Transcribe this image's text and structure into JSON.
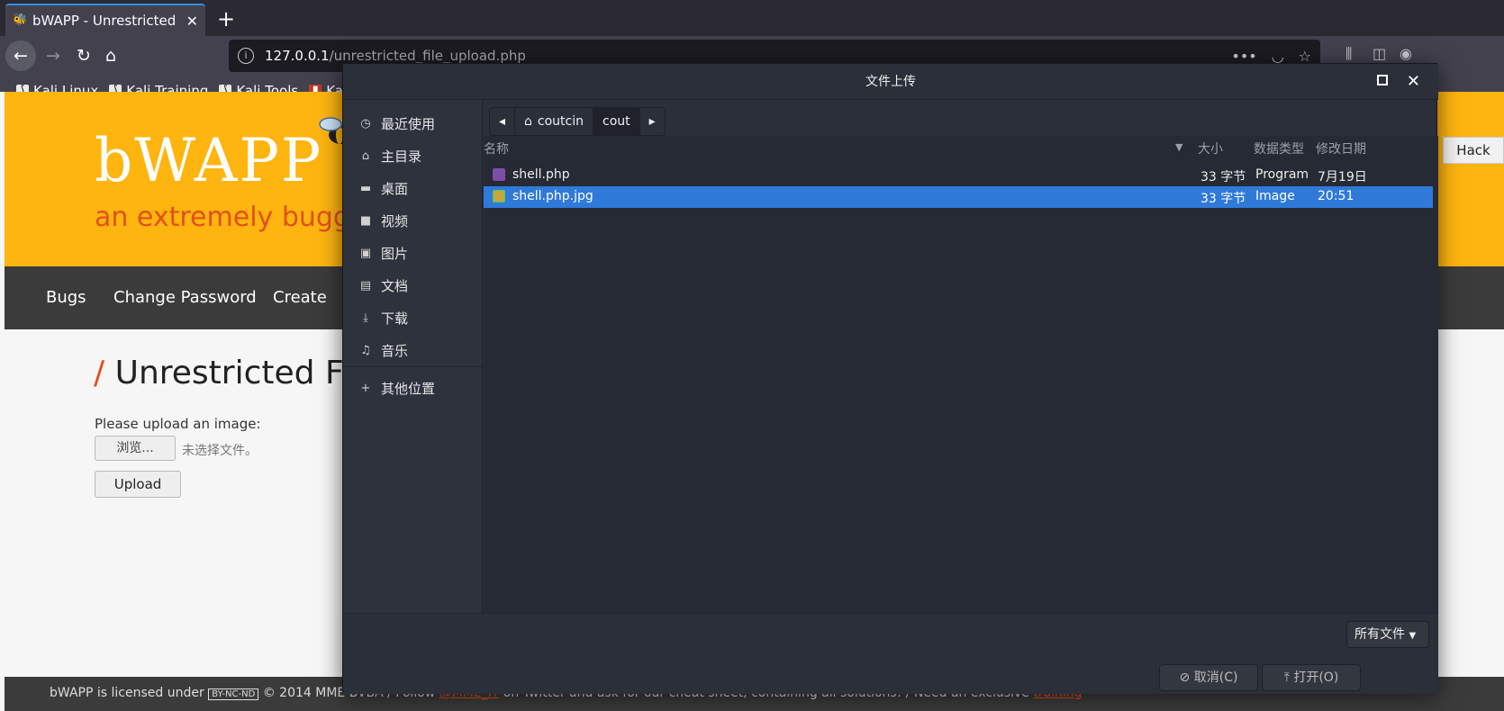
{
  "browser": {
    "tab_title": "bWAPP - Unrestricted Fi",
    "url_host": "127.0.0.1",
    "url_path": "/unrestricted_file_upload.php",
    "bookmarks": [
      "Kali Linux",
      "Kali Training",
      "Kali Tools",
      "Kali D"
    ]
  },
  "page": {
    "logo": "bWAPP",
    "tagline": "an extremely buggy",
    "menu": [
      "Bugs",
      "Change Password",
      "Create"
    ],
    "hack_label": "Hack",
    "title_slash": "/",
    "title": "Unrestricted F",
    "upload_label": "Please upload an image:",
    "browse_label": "浏览...",
    "no_file": "未选择文件。",
    "upload_btn": "Upload",
    "footer_text1": "bWAPP is licensed under",
    "footer_cc": "BY-NC-ND",
    "footer_text2": "© 2014 MME BVBA / Follow",
    "footer_link1": "@MME_IT",
    "footer_text3": "on Twitter and ask for our cheat sheet, containing all solutions! / Need an exclusive",
    "footer_link2": "training"
  },
  "dialog": {
    "title": "文件上传",
    "sidebar": [
      {
        "icon": "clock-icon",
        "glyph": "◷",
        "label": "最近使用"
      },
      {
        "icon": "home-icon",
        "glyph": "⌂",
        "label": "主目录"
      },
      {
        "icon": "desktop-icon",
        "glyph": "▬",
        "label": "桌面"
      },
      {
        "icon": "video-icon",
        "glyph": "■",
        "label": "视频"
      },
      {
        "icon": "picture-icon",
        "glyph": "▣",
        "label": "图片"
      },
      {
        "icon": "document-icon",
        "glyph": "▤",
        "label": "文档"
      },
      {
        "icon": "download-icon",
        "glyph": "⤓",
        "label": "下载"
      },
      {
        "icon": "music-icon",
        "glyph": "♫",
        "label": "音乐"
      }
    ],
    "other_locations": "其他位置",
    "path": [
      "coutcin",
      "cout"
    ],
    "columns": {
      "name": "名称",
      "size": "大小",
      "type": "数据类型",
      "modified": "修改日期"
    },
    "files": [
      {
        "name": "shell.php",
        "size": "33 字节",
        "type": "Program",
        "modified": "7月19日",
        "selected": false
      },
      {
        "name": "shell.php.jpg",
        "size": "33 字节",
        "type": "Image",
        "modified": "20:51",
        "selected": true
      }
    ],
    "filter": "所有文件",
    "cancel": "取消(C)",
    "open": "打开(O)"
  }
}
